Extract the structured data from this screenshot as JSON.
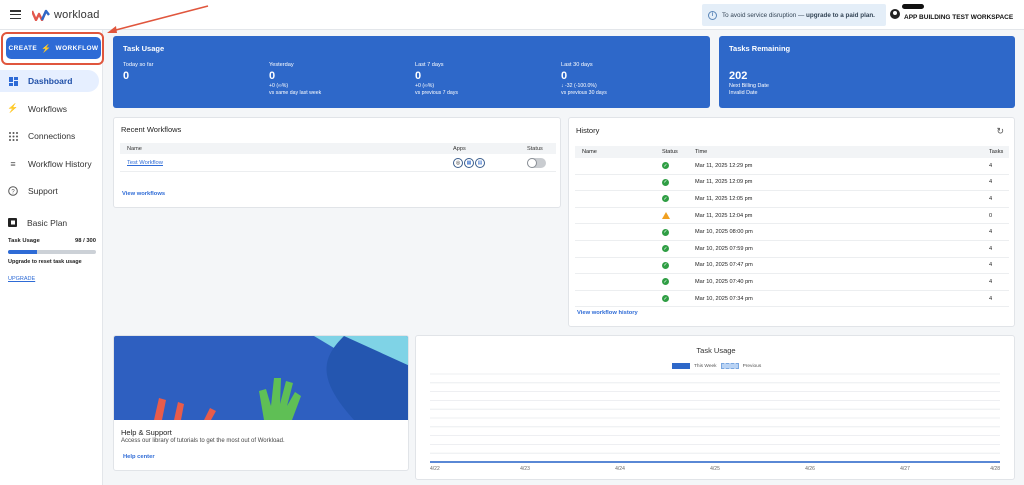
{
  "app": {
    "name": "workload"
  },
  "banner": {
    "text": "To avoid service disruption — ",
    "cta": "upgrade to a paid plan."
  },
  "account": {
    "workspace": "APP BUILDING TEST WORKSPACE"
  },
  "sidebar": {
    "create_label_1": "CREATE",
    "create_label_2": "WORKFLOW",
    "items": [
      {
        "label": "Dashboard",
        "icon": "dashboard-icon"
      },
      {
        "label": "Workflows",
        "icon": "workflows-icon"
      },
      {
        "label": "Connections",
        "icon": "connections-icon"
      },
      {
        "label": "Workflow History",
        "icon": "history-icon"
      },
      {
        "label": "Support",
        "icon": "support-icon"
      }
    ],
    "plan": {
      "name": "Basic Plan",
      "usage_label": "Task Usage",
      "usage_value": "98 / 300",
      "usage_fraction": 0.3267,
      "note": "Upgrade to reset task usage",
      "upgrade": "UPGRADE"
    }
  },
  "task_usage": {
    "title": "Task Usage",
    "cols": [
      {
        "label": "Today so far",
        "value": "0",
        "delta": "",
        "compare": ""
      },
      {
        "label": "Yesterday",
        "value": "0",
        "delta": "+0 (∞%)",
        "compare": "vs same day last week"
      },
      {
        "label": "Last 7 days",
        "value": "0",
        "delta": "+0 (∞%)",
        "compare": "vs previous 7 days"
      },
      {
        "label": "Last 30 days",
        "value": "0",
        "delta": "-32 (-100.0%)",
        "compare": "vs previous 30 days"
      }
    ]
  },
  "tasks_remaining": {
    "title": "Tasks Remaining",
    "value": "202",
    "line1": "Next Billing Date",
    "line2": "Invalid Date"
  },
  "recent_workflows": {
    "title": "Recent Workflows",
    "headers": {
      "name": "Name",
      "apps": "Apps",
      "status": "Status"
    },
    "rows": [
      {
        "name": "Test Workflow"
      }
    ],
    "link": "View workflows"
  },
  "history": {
    "title": "History",
    "headers": {
      "name": "Name",
      "status": "Status",
      "time": "Time",
      "tasks": "Tasks"
    },
    "rows": [
      {
        "status": "success",
        "time": "Mar 11, 2025 12:29 pm",
        "tasks": "4"
      },
      {
        "status": "success",
        "time": "Mar 11, 2025 12:09 pm",
        "tasks": "4"
      },
      {
        "status": "success",
        "time": "Mar 11, 2025 12:05 pm",
        "tasks": "4"
      },
      {
        "status": "warning",
        "time": "Mar 11, 2025 12:04 pm",
        "tasks": "0"
      },
      {
        "status": "success",
        "time": "Mar 10, 2025 08:00 pm",
        "tasks": "4"
      },
      {
        "status": "success",
        "time": "Mar 10, 2025 07:59 pm",
        "tasks": "4"
      },
      {
        "status": "success",
        "time": "Mar 10, 2025 07:47 pm",
        "tasks": "4"
      },
      {
        "status": "success",
        "time": "Mar 10, 2025 07:40 pm",
        "tasks": "4"
      },
      {
        "status": "success",
        "time": "Mar 10, 2025 07:34 pm",
        "tasks": "4"
      }
    ],
    "link": "View workflow history"
  },
  "help": {
    "title": "Help & Support",
    "subtitle": "Access our library of tutorials to get the most out of Workload.",
    "link": "Help center"
  },
  "chart_data": {
    "type": "line",
    "title": "Task Usage",
    "categories": [
      "4/22",
      "4/23",
      "4/24",
      "4/25",
      "4/26",
      "4/27",
      "4/28"
    ],
    "series": [
      {
        "name": "This Week",
        "values": [
          0,
          0,
          0,
          0,
          0,
          0,
          0
        ],
        "color": "#2e68c9"
      },
      {
        "name": "Previous",
        "values": [
          0,
          0,
          0,
          0,
          0,
          0,
          0
        ],
        "color": "#b9d3f4"
      }
    ],
    "grid": true,
    "legend": "top-center"
  },
  "colors": {
    "primary": "#2e6bd6",
    "card_blue": "#2e68c9",
    "success": "#2f9e44",
    "warning": "#f0a020",
    "highlight": "#e0563d"
  }
}
